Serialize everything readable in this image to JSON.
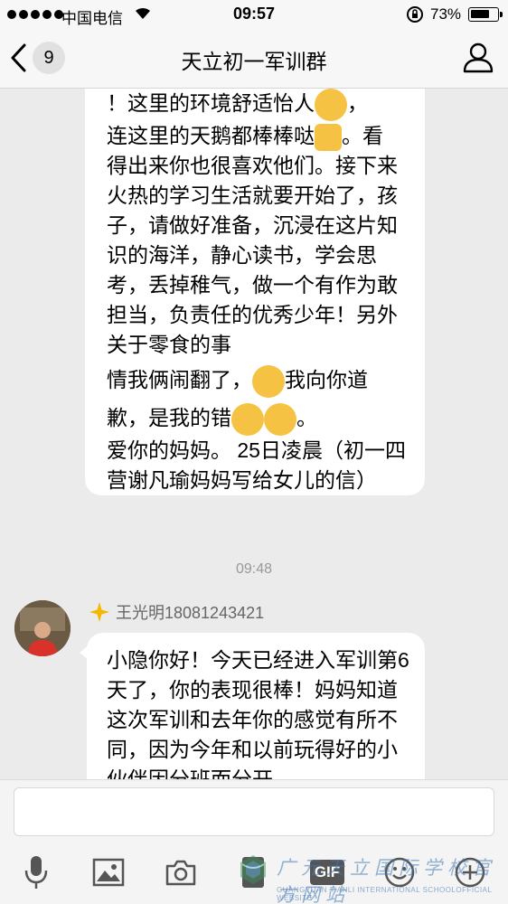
{
  "status_bar": {
    "carrier": "中国电信",
    "time": "09:57",
    "battery_text": "73%",
    "battery_level": 0.73
  },
  "nav": {
    "unread_count": "9",
    "title": "天立初一军训群"
  },
  "messages": {
    "msg1": {
      "line1": "！这里的环境舒适怡人",
      "line1_end": "，",
      "line2": "连这里的天鹅都棒棒哒",
      "line2_end": "。看",
      "rest": "得出来你也很喜欢他们。接下来火热的学习生活就要开始了，孩子，请做好准备，沉浸在这片知识的海洋，静心读书，学会思考，丢掉稚气，做一个有作为敢担当，负责任的优秀少年！另外关于零食的事",
      "line_apology_a": "情我俩闹翻了，",
      "line_apology_b": "我向你道",
      "line_fault": "歉，是我的错",
      "line_fault_end": "。",
      "signoff": "爱你的妈妈。 25日凌晨（初一四营谢凡瑜妈妈写给女儿的信）"
    },
    "timestamp": "09:48",
    "msg2": {
      "sender": "王光明18081243421",
      "text": "小隐你好！今天已经进入军训第6天了，你的表现很棒！妈妈知道这次军训和去年你的感觉有所不同，因为今年和以前玩得好的小伙伴因分班而分开"
    }
  },
  "input": {
    "value": "",
    "placeholder": ""
  },
  "toolbar": {
    "gif_label": "GIF"
  },
  "watermark": {
    "cn": "广元天立国际学校官方网站",
    "en": "GUANGYUAN TIANLI INTERNATIONAL SCHOOLOFFICIAL WEBSITE"
  },
  "colors": {
    "bubble": "#ffffff",
    "background": "#ebebeb",
    "emoji": "#f6c243",
    "vip_star": "#f5b700"
  }
}
